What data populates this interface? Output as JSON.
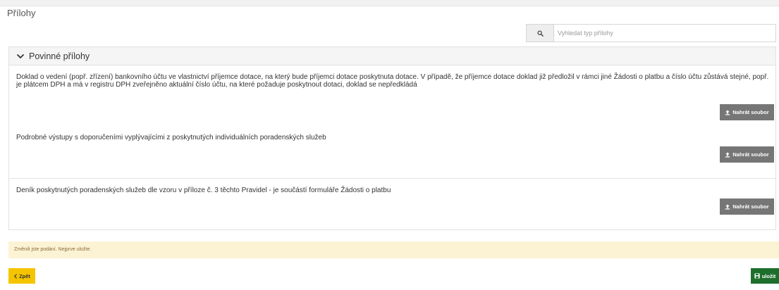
{
  "page": {
    "title": "Přílohy"
  },
  "search": {
    "placeholder": "Vyhledat typ přílohy",
    "value": "",
    "icon": "search-icon"
  },
  "panel": {
    "title": "Povinné přílohy",
    "icon": "chevron-down-icon",
    "expanded": true
  },
  "attachments": [
    {
      "text": "Doklad o vedení (popř. zřízení) bankovního účtu ve vlastnictví příjemce dotace, na který bude příjemci dotace poskytnuta dotace. V případě, že příjemce dotace doklad již předložil v rámci jiné Žádosti o platbu a číslo účtu zůstává stejné, popř. je plátcem DPH a má v registru DPH zveřejněno aktuální číslo účtu, na které požaduje poskytnout dotaci, doklad se nepředkládá",
      "button_label": "Nahrát soubor"
    },
    {
      "text": "Podrobné výstupy s doporučeními vyplývajícími z poskytnutých individuálních poradenských služeb",
      "button_label": "Nahrát soubor"
    },
    {
      "text": "Deník poskytnutých poradenských služeb dle vzoru v příloze č. 3 těchto Pravidel - je součástí formuláře Žádosti o platbu",
      "button_label": "Nahrát soubor"
    }
  ],
  "warning": {
    "text": "Změnili jste podání. Nejprve uložte."
  },
  "footer": {
    "back_label": "Zpět",
    "save_label": "uložit"
  },
  "colors": {
    "warning_bg": "#fcf3d4",
    "back_button": "#f5c400",
    "save_button": "#1e6e2c",
    "upload_button": "#767676"
  }
}
